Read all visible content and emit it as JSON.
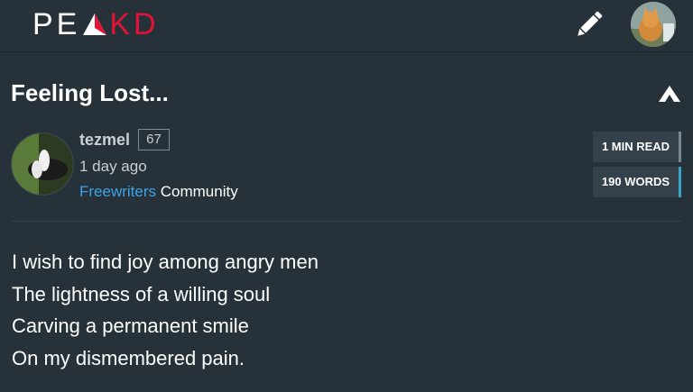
{
  "header": {
    "logo_left": "PE",
    "logo_right": "KD",
    "brand_color": "#e31337",
    "edit_icon": "pencil-icon",
    "user_avatar": "user-avatar"
  },
  "post": {
    "title": "Feeling Lost...",
    "author": "tezmel",
    "reputation": "67",
    "time": "1 day ago",
    "community_link": "Freewriters",
    "community_suffix": " Community",
    "read_time": "1 MIN READ",
    "word_count": "190 WORDS",
    "body_lines": [
      "I wish to find joy among angry men",
      "The lightness of a willing soul",
      "Carving a permanent smile",
      "On my dismembered pain."
    ]
  },
  "colors": {
    "background": "#263139",
    "link": "#3fa3e6",
    "accent_blue": "#3aa3c8"
  }
}
